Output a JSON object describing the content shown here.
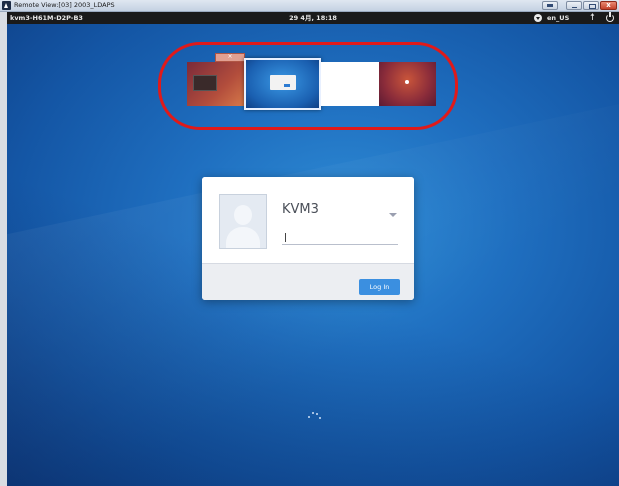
{
  "window": {
    "title": "Remote View:[03] 2003_LDAPS",
    "close_label": "x"
  },
  "top_panel": {
    "host": "kvm3-H61M-D2P-B3",
    "clock": "29 4月, 18:18",
    "language": "en_US",
    "accessibility_icon": "accessibility-icon",
    "power_icon": "power-icon"
  },
  "workspaces": {
    "count": 4,
    "active_index": 1,
    "highlight_color": "#e01a1a"
  },
  "login": {
    "username": "KVM3",
    "password_value": "",
    "button_label": "Log In"
  },
  "colors": {
    "desktop_blue": "#1f6fc0",
    "panel": "#1a1a1a",
    "button": "#3b8fe0"
  }
}
